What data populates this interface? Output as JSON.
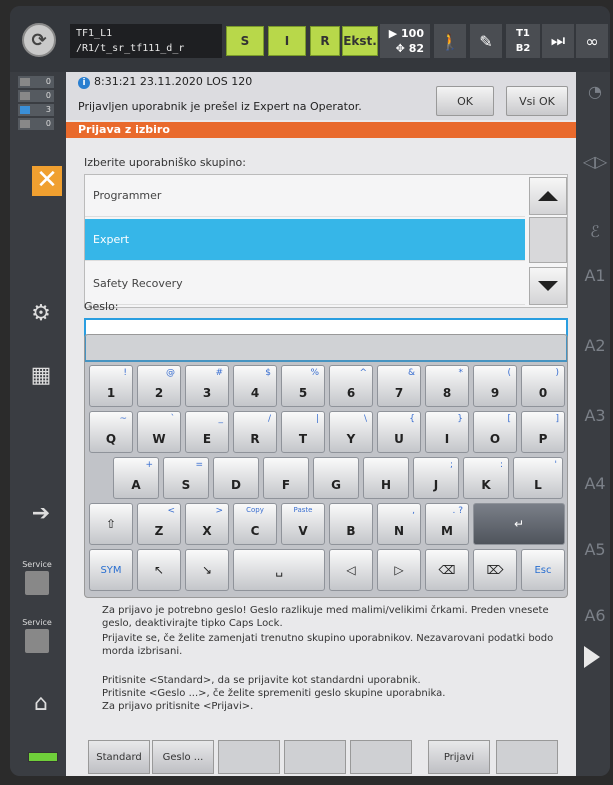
{
  "topbar": {
    "robot_name_line1": "TF1_L1",
    "robot_name_line2": "/R1/t_sr_tf111_d_r",
    "status_buttons": [
      "S",
      "I",
      "R",
      "Ekst."
    ],
    "speed_top": "100",
    "speed_bottom": "82",
    "tool_line1": "T1",
    "tool_line2": "B2",
    "infinity": "∞"
  },
  "counters": [
    {
      "value": "0"
    },
    {
      "value": "0"
    },
    {
      "value": "3"
    },
    {
      "value": "0"
    }
  ],
  "message": {
    "timestamp": "8:31:21 23.11.2020 LOS 120",
    "text": "Prijavljen uporabnik je prešel iz Expert na Operator.",
    "ok_label": "OK",
    "all_ok_label": "Vsi OK"
  },
  "dialog": {
    "title": "Prijava z izbiro",
    "prompt": "Izberite uporabniško skupino:",
    "groups": [
      "Programmer",
      "Expert",
      "Safety Recovery"
    ],
    "selected_index": 1,
    "password_label": "Geslo:"
  },
  "keyboard": {
    "row1": [
      {
        "k": "1",
        "s": "!"
      },
      {
        "k": "2",
        "s": "@"
      },
      {
        "k": "3",
        "s": "#"
      },
      {
        "k": "4",
        "s": "$"
      },
      {
        "k": "5",
        "s": "%"
      },
      {
        "k": "6",
        "s": "^"
      },
      {
        "k": "7",
        "s": "&"
      },
      {
        "k": "8",
        "s": "*"
      },
      {
        "k": "9",
        "s": "("
      },
      {
        "k": "0",
        "s": ")"
      }
    ],
    "row2": [
      {
        "k": "Q",
        "s": "~"
      },
      {
        "k": "W",
        "s": "`"
      },
      {
        "k": "E",
        "s": "_"
      },
      {
        "k": "R",
        "s": "/"
      },
      {
        "k": "T",
        "s": "|"
      },
      {
        "k": "Y",
        "s": "\\"
      },
      {
        "k": "U",
        "s": "{"
      },
      {
        "k": "I",
        "s": "}"
      },
      {
        "k": "O",
        "s": "["
      },
      {
        "k": "P",
        "s": "]"
      }
    ],
    "row3": [
      {
        "k": "A",
        "s": "+"
      },
      {
        "k": "S",
        "s": "="
      },
      {
        "k": "D",
        "s": ""
      },
      {
        "k": "F",
        "s": ""
      },
      {
        "k": "G",
        "s": ""
      },
      {
        "k": "H",
        "s": ""
      },
      {
        "k": "J",
        "s": ";"
      },
      {
        "k": "K",
        "s": ":"
      },
      {
        "k": "L",
        "s": "'"
      }
    ],
    "row4": [
      {
        "k": "Z",
        "s": "<"
      },
      {
        "k": "X",
        "s": ">"
      },
      {
        "k": "C",
        "s": "Copy"
      },
      {
        "k": "V",
        "s": "Paste"
      },
      {
        "k": "B",
        "s": ""
      },
      {
        "k": "N",
        "s": ","
      },
      {
        "k": "M",
        "s": ". ?"
      }
    ],
    "sym_label": "SYM",
    "esc_label": "Esc"
  },
  "help": {
    "p1": "Za prijavo je potrebno geslo! Geslo razlikuje med malimi/velikimi črkami. Preden vnesete geslo, deaktivirajte tipko Caps Lock.",
    "p2": "Prijavite se, če želite zamenjati trenutno skupino uporabnikov. Nezavarovani podatki bodo morda izbrisani.",
    "p3": "Pritisnite <Standard>, da se prijavite kot standardni uporabnik.",
    "p4": "Pritisnite <Geslo ...>, če želite spremeniti geslo skupine uporabnika.",
    "p5": "Za prijavo pritisnite <Prijavi>."
  },
  "softkeys": {
    "standard": "Standard",
    "password": "Geslo ...",
    "login": "Prijavi"
  },
  "axes": [
    "A1",
    "A2",
    "A3",
    "A4",
    "A5",
    "A6"
  ],
  "service_label": "Service",
  "colors": {
    "title_orange": "#e96a2c",
    "selection_blue": "#36b6e8",
    "status_green": "#b8d84a"
  }
}
